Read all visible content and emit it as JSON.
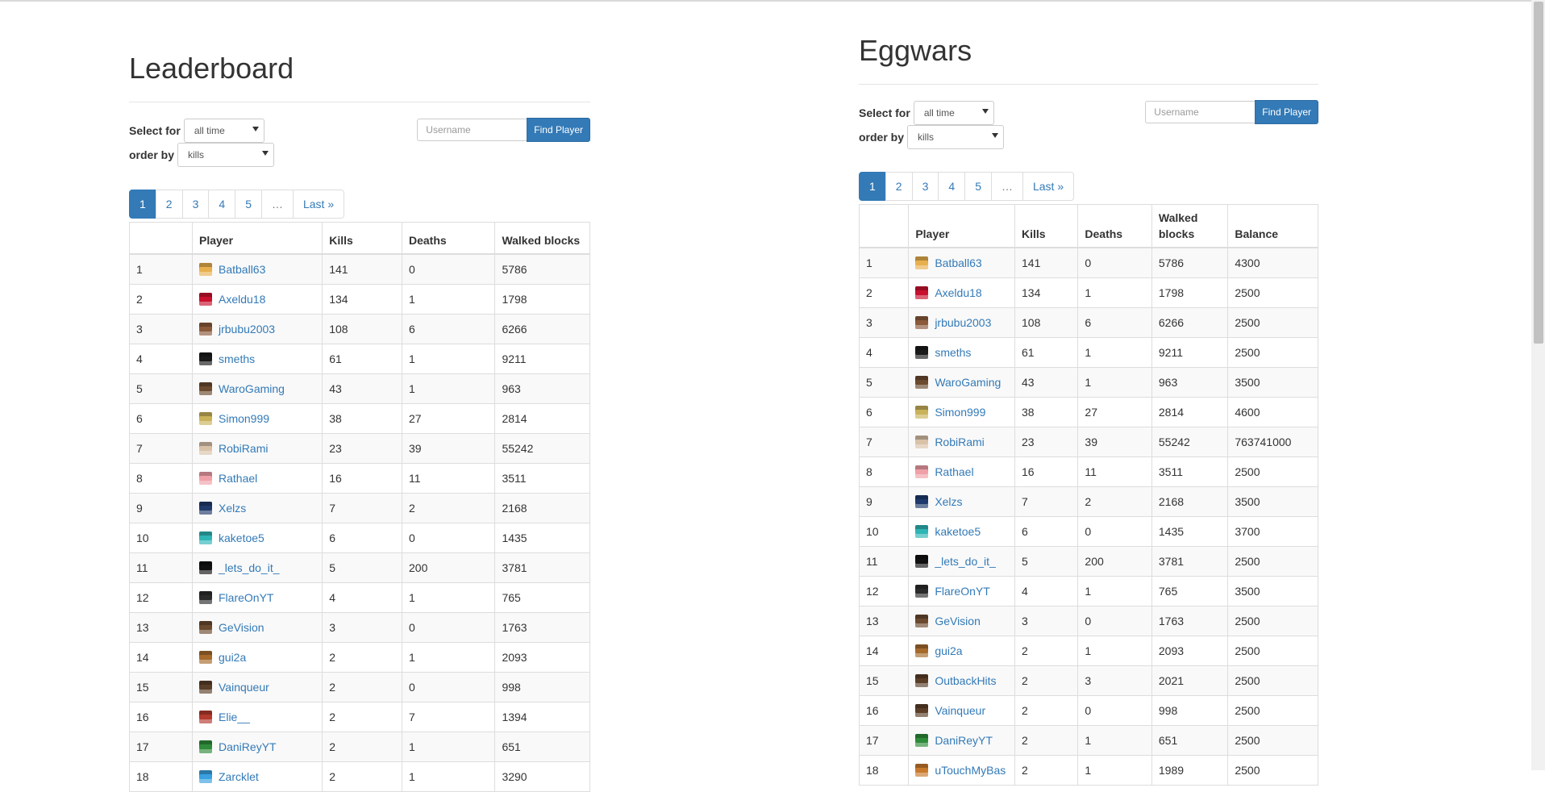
{
  "left": {
    "title": "Leaderboard",
    "select_for_label": "Select for",
    "select_for_value": "all time",
    "order_by_label": "order by",
    "order_by_value": "kills",
    "username_placeholder": "Username",
    "find_button": "Find Player",
    "pages": [
      "1",
      "2",
      "3",
      "4",
      "5",
      "…",
      "Last »"
    ],
    "columns": [
      "",
      "Player",
      "Kills",
      "Deaths",
      "Walked blocks"
    ],
    "rows": [
      {
        "rank": "1",
        "player": "Batball63",
        "kills": "141",
        "deaths": "0",
        "walked": "5786",
        "color": "#e8b04d"
      },
      {
        "rank": "2",
        "player": "Axeldu18",
        "kills": "134",
        "deaths": "1",
        "walked": "1798",
        "color": "#c8102e"
      },
      {
        "rank": "3",
        "player": "jrbubu2003",
        "kills": "108",
        "deaths": "6",
        "walked": "6266",
        "color": "#8a5a3b"
      },
      {
        "rank": "4",
        "player": "smeths",
        "kills": "61",
        "deaths": "1",
        "walked": "9211",
        "color": "#1a1a1a"
      },
      {
        "rank": "5",
        "player": "WaroGaming",
        "kills": "43",
        "deaths": "1",
        "walked": "963",
        "color": "#6b4a2f"
      },
      {
        "rank": "6",
        "player": "Simon999",
        "kills": "38",
        "deaths": "27",
        "walked": "2814",
        "color": "#c9b25a"
      },
      {
        "rank": "7",
        "player": "RobiRami",
        "kills": "23",
        "deaths": "39",
        "walked": "55242",
        "color": "#d9c2a8"
      },
      {
        "rank": "8",
        "player": "Rathael",
        "kills": "16",
        "deaths": "11",
        "walked": "3511",
        "color": "#f0a0a8"
      },
      {
        "rank": "9",
        "player": "Xelzs",
        "kills": "7",
        "deaths": "2",
        "walked": "2168",
        "color": "#1f3a6b"
      },
      {
        "rank": "10",
        "player": "kaketoe5",
        "kills": "6",
        "deaths": "0",
        "walked": "1435",
        "color": "#2fb5b5"
      },
      {
        "rank": "11",
        "player": "_lets_do_it_",
        "kills": "5",
        "deaths": "200",
        "walked": "3781",
        "color": "#111111"
      },
      {
        "rank": "12",
        "player": "FlareOnYT",
        "kills": "4",
        "deaths": "1",
        "walked": "765",
        "color": "#2b2b2b"
      },
      {
        "rank": "13",
        "player": "GeVision",
        "kills": "3",
        "deaths": "0",
        "walked": "1763",
        "color": "#6b4a2f"
      },
      {
        "rank": "14",
        "player": "gui2a",
        "kills": "2",
        "deaths": "1",
        "walked": "2093",
        "color": "#a56a2c"
      },
      {
        "rank": "15",
        "player": "Vainqueur",
        "kills": "2",
        "deaths": "0",
        "walked": "998",
        "color": "#5a3e28"
      },
      {
        "rank": "16",
        "player": "Elie__",
        "kills": "2",
        "deaths": "7",
        "walked": "1394",
        "color": "#b23a2e"
      },
      {
        "rank": "17",
        "player": "DaniReyYT",
        "kills": "2",
        "deaths": "1",
        "walked": "651",
        "color": "#2e8b3a"
      },
      {
        "rank": "18",
        "player": "Zarcklet",
        "kills": "2",
        "deaths": "1",
        "walked": "3290",
        "color": "#3aa0e0"
      }
    ]
  },
  "right": {
    "title": "Eggwars",
    "select_for_label": "Select for",
    "select_for_value": "all time",
    "order_by_label": "order by",
    "order_by_value": "kills",
    "username_placeholder": "Username",
    "find_button": "Find Player",
    "pages": [
      "1",
      "2",
      "3",
      "4",
      "5",
      "…",
      "Last »"
    ],
    "columns": [
      "",
      "Player",
      "Kills",
      "Deaths",
      "Walked blocks",
      "Balance"
    ],
    "rows": [
      {
        "rank": "1",
        "player": "Batball63",
        "kills": "141",
        "deaths": "0",
        "walked": "5786",
        "balance": "4300",
        "color": "#e8b04d"
      },
      {
        "rank": "2",
        "player": "Axeldu18",
        "kills": "134",
        "deaths": "1",
        "walked": "1798",
        "balance": "2500",
        "color": "#c8102e"
      },
      {
        "rank": "3",
        "player": "jrbubu2003",
        "kills": "108",
        "deaths": "6",
        "walked": "6266",
        "balance": "2500",
        "color": "#8a5a3b"
      },
      {
        "rank": "4",
        "player": "smeths",
        "kills": "61",
        "deaths": "1",
        "walked": "9211",
        "balance": "2500",
        "color": "#1a1a1a"
      },
      {
        "rank": "5",
        "player": "WaroGaming",
        "kills": "43",
        "deaths": "1",
        "walked": "963",
        "balance": "3500",
        "color": "#6b4a2f"
      },
      {
        "rank": "6",
        "player": "Simon999",
        "kills": "38",
        "deaths": "27",
        "walked": "2814",
        "balance": "4600",
        "color": "#c9b25a"
      },
      {
        "rank": "7",
        "player": "RobiRami",
        "kills": "23",
        "deaths": "39",
        "walked": "55242",
        "balance": "763741000",
        "color": "#d9c2a8"
      },
      {
        "rank": "8",
        "player": "Rathael",
        "kills": "16",
        "deaths": "11",
        "walked": "3511",
        "balance": "2500",
        "color": "#f0a0a8"
      },
      {
        "rank": "9",
        "player": "Xelzs",
        "kills": "7",
        "deaths": "2",
        "walked": "2168",
        "balance": "3500",
        "color": "#1f3a6b"
      },
      {
        "rank": "10",
        "player": "kaketoe5",
        "kills": "6",
        "deaths": "0",
        "walked": "1435",
        "balance": "3700",
        "color": "#2fb5b5"
      },
      {
        "rank": "11",
        "player": "_lets_do_it_",
        "kills": "5",
        "deaths": "200",
        "walked": "3781",
        "balance": "2500",
        "color": "#111111"
      },
      {
        "rank": "12",
        "player": "FlareOnYT",
        "kills": "4",
        "deaths": "1",
        "walked": "765",
        "balance": "3500",
        "color": "#2b2b2b"
      },
      {
        "rank": "13",
        "player": "GeVision",
        "kills": "3",
        "deaths": "0",
        "walked": "1763",
        "balance": "2500",
        "color": "#6b4a2f"
      },
      {
        "rank": "14",
        "player": "gui2a",
        "kills": "2",
        "deaths": "1",
        "walked": "2093",
        "balance": "2500",
        "color": "#a56a2c"
      },
      {
        "rank": "15",
        "player": "OutbackHits",
        "kills": "2",
        "deaths": "3",
        "walked": "2021",
        "balance": "2500",
        "color": "#5a3e28"
      },
      {
        "rank": "16",
        "player": "Vainqueur",
        "kills": "2",
        "deaths": "0",
        "walked": "998",
        "balance": "2500",
        "color": "#5a3e28"
      },
      {
        "rank": "17",
        "player": "DaniReyYT",
        "kills": "2",
        "deaths": "1",
        "walked": "651",
        "balance": "2500",
        "color": "#2e8b3a"
      },
      {
        "rank": "18",
        "player": "uTouchMyBas",
        "kills": "2",
        "deaths": "1",
        "walked": "1989",
        "balance": "2500",
        "color": "#c87a2c"
      }
    ]
  }
}
